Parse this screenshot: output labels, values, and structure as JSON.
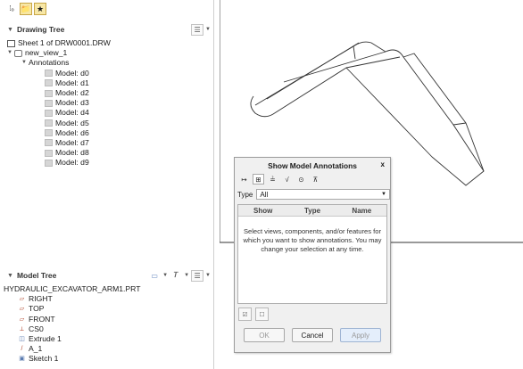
{
  "drawing_tree": {
    "title": "Drawing Tree",
    "items": [
      {
        "label": "Sheet 1 of DRW0001.DRW",
        "level": 0,
        "icon": "sheet-icon"
      },
      {
        "label": "new_view_1",
        "level": 0,
        "icon": "view-icon",
        "expanded": true
      },
      {
        "label": "Annotations",
        "level": 1,
        "expanded": true
      },
      {
        "label": "Model: d0",
        "level": 2
      },
      {
        "label": "Model: d1",
        "level": 2
      },
      {
        "label": "Model: d2",
        "level": 2
      },
      {
        "label": "Model: d3",
        "level": 2
      },
      {
        "label": "Model: d4",
        "level": 2
      },
      {
        "label": "Model: d5",
        "level": 2
      },
      {
        "label": "Model: d6",
        "level": 2
      },
      {
        "label": "Model: d7",
        "level": 2
      },
      {
        "label": "Model: d8",
        "level": 2
      },
      {
        "label": "Model: d9",
        "level": 2
      }
    ]
  },
  "model_tree": {
    "title": "Model Tree",
    "root": "HYDRAULIC_EXCAVATOR_ARM1.PRT",
    "items": [
      {
        "label": "RIGHT",
        "icon": "datum-plane-icon"
      },
      {
        "label": "TOP",
        "icon": "datum-plane-icon"
      },
      {
        "label": "FRONT",
        "icon": "datum-plane-icon"
      },
      {
        "label": "CS0",
        "icon": "coordinate-system-icon"
      },
      {
        "label": "Extrude 1",
        "icon": "extrude-icon"
      },
      {
        "label": "A_1",
        "icon": "axis-icon"
      },
      {
        "label": "Sketch 1",
        "icon": "sketch-icon"
      }
    ]
  },
  "dialog": {
    "title": "Show Model Annotations",
    "close": "x",
    "type_label": "Type",
    "type_value": "All",
    "columns": [
      "Show",
      "Type",
      "Name"
    ],
    "message": "Select views, components, and/or features for which you want to show annotations. You may change your selection at any time.",
    "buttons": {
      "ok": "OK",
      "cancel": "Cancel",
      "apply": "Apply"
    }
  },
  "colors": {
    "accent": "#f7e7a6",
    "apply_bg": "#e4eefb"
  }
}
